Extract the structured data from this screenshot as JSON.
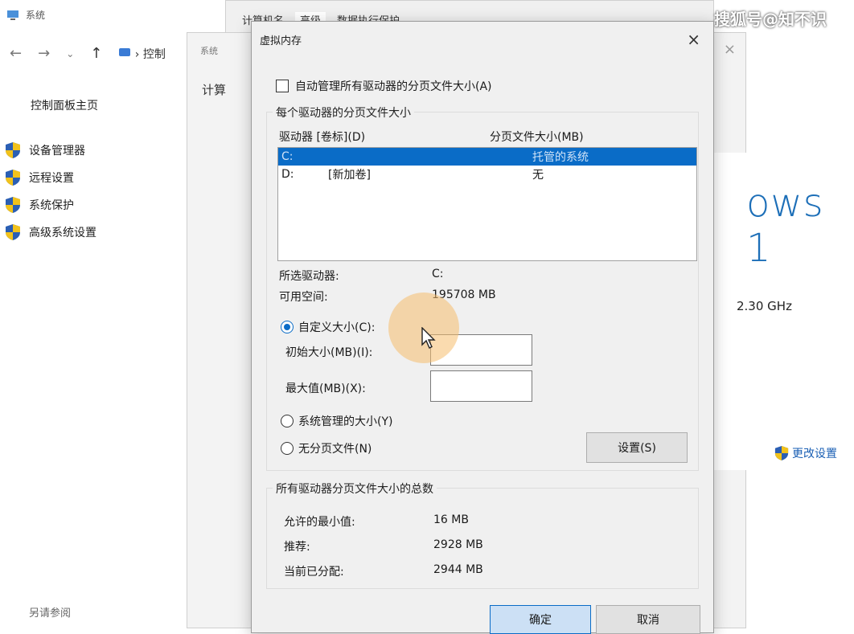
{
  "background": {
    "window_title": "系统",
    "breadcrumb": "控制",
    "control_panel_home": "控制面板主页",
    "side_links": [
      "设备管理器",
      "远程设置",
      "系统保护",
      "高级系统设置"
    ],
    "see_also": "另请参阅",
    "windows_logo_text": "ows 1",
    "cpu_speed": "2.30 GHz",
    "change_settings": "更改设置"
  },
  "middle_window": {
    "title": "系统",
    "heading": "计算"
  },
  "back_window": {
    "tabs": [
      "计算机名",
      "高级",
      "数据执行保护"
    ]
  },
  "watermark": "搜狐号@知不识",
  "dialog": {
    "title": "虚拟内存",
    "close_glyph": "×",
    "auto_manage_label": "自动管理所有驱动器的分页文件大小(A)",
    "per_drive_group": "每个驱动器的分页文件大小",
    "columns": {
      "drive": "驱动器 [卷标](D)",
      "size": "分页文件大小(MB)"
    },
    "drives": [
      {
        "drive": "C:",
        "label": "",
        "size": "托管的系统"
      },
      {
        "drive": "D:",
        "label": "[新加卷]",
        "size": "无"
      }
    ],
    "selected_drive_label": "所选驱动器:",
    "selected_drive_value": "C:",
    "free_space_label": "可用空间:",
    "free_space_value": "195708 MB",
    "custom_size_label": "自定义大小(C):",
    "initial_size_label": "初始大小(MB)(I):",
    "initial_size_value": "",
    "max_size_label": "最大值(MB)(X):",
    "max_size_value": "",
    "system_managed_label": "系统管理的大小(Y)",
    "no_paging_label": "无分页文件(N)",
    "set_button": "设置(S)",
    "totals_group": "所有驱动器分页文件大小的总数",
    "min_allowed_label": "允许的最小值:",
    "min_allowed_value": "16 MB",
    "recommended_label": "推荐:",
    "recommended_value": "2928 MB",
    "allocated_label": "当前已分配:",
    "allocated_value": "2944 MB",
    "ok_button": "确定",
    "cancel_button": "取消"
  }
}
